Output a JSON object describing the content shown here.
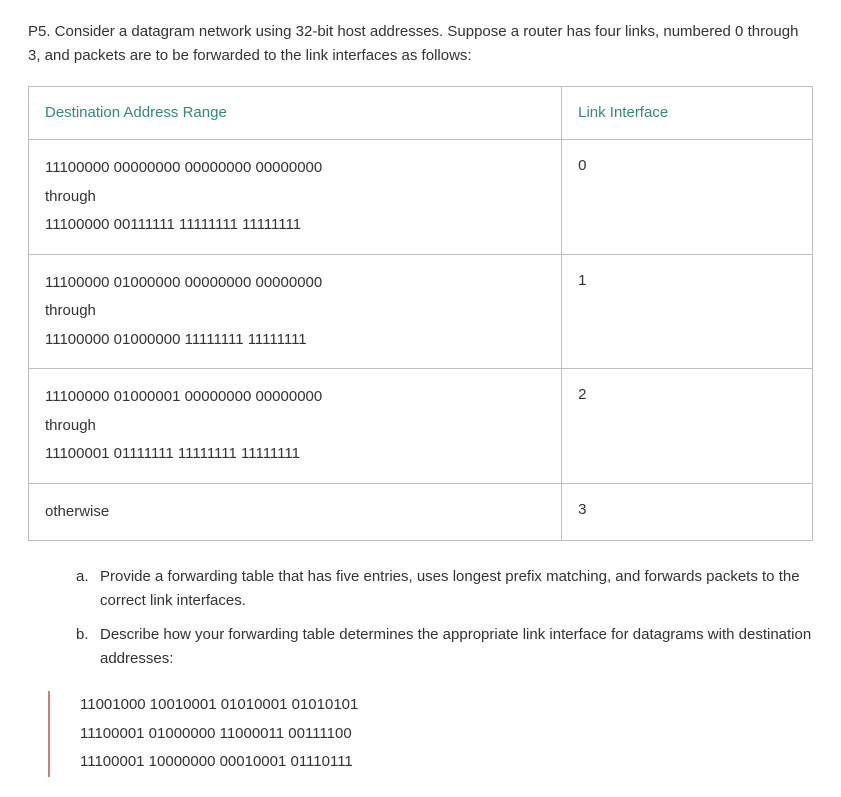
{
  "intro": "P5. Consider a datagram network using 32-bit host addresses. Suppose a router has four links, numbered 0 through 3, and packets are to be forwarded to the link interfaces as follows:",
  "table": {
    "headers": {
      "col1": "Destination Address Range",
      "col2": "Link Interface"
    },
    "rows": [
      {
        "lines": [
          "11100000 00000000 00000000 00000000",
          "through",
          "11100000 00111111 11111111 11111111"
        ],
        "interface": "0"
      },
      {
        "lines": [
          "11100000 01000000 00000000 00000000",
          "through",
          "11100000 01000000 11111111 11111111"
        ],
        "interface": "1"
      },
      {
        "lines": [
          "11100000 01000001 00000000 00000000",
          "through",
          "11100001 01111111 11111111 11111111"
        ],
        "interface": "2"
      },
      {
        "lines": [
          "otherwise"
        ],
        "interface": "3"
      }
    ]
  },
  "questions": {
    "a": {
      "marker": "a.",
      "text": "Provide a forwarding table that has five entries, uses longest prefix matching, and forwards packets to the correct link interfaces."
    },
    "b": {
      "marker": "b.",
      "text": "Describe how your forwarding table determines the appropriate link interface for datagrams with destination addresses:"
    }
  },
  "addresses": [
    "11001000 10010001 01010001 01010101",
    "11100001 01000000 11000011 00111100",
    "11100001 10000000 00010001 01110111"
  ]
}
